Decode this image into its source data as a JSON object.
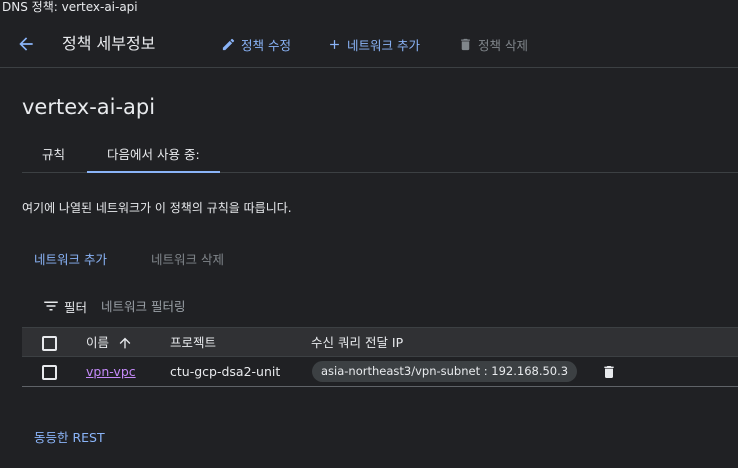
{
  "window": {
    "title": "DNS 정책: vertex-ai-api"
  },
  "toolbar": {
    "heading": "정책 세부정보",
    "edit_label": "정책 수정",
    "add_network_label": "네트워크 추가",
    "delete_policy_label": "정책 삭제"
  },
  "policy": {
    "name": "vertex-ai-api"
  },
  "tabs": [
    {
      "label": "규칙",
      "active": false
    },
    {
      "label": "다음에서 사용 중:",
      "active": true
    }
  ],
  "description": "여기에 나열된 네트워크가 이 정책의 규칙을 따릅니다.",
  "actions": {
    "add_network": "네트워크 추가",
    "delete_network": "네트워크 삭제"
  },
  "filter": {
    "label": "필터",
    "placeholder": "네트워크 필터링"
  },
  "table": {
    "columns": {
      "name": "이름",
      "project": "프로젝트",
      "forwarding_ip": "수신 쿼리 전달 IP"
    },
    "rows": [
      {
        "name": "vpn-vpc",
        "project": "ctu-gcp-dsa2-unit",
        "forwarding_ip": "asia-northeast3/vpn-subnet : 192.168.50.3"
      }
    ]
  },
  "footer": {
    "equivalent_rest": "동등한 REST"
  },
  "icons": {
    "back": "arrow-left-icon",
    "edit": "pencil-icon",
    "add": "plus-icon",
    "delete": "trash-icon",
    "filter": "filter-list-icon",
    "sort": "arrow-up-icon"
  },
  "colors": {
    "background": "#202124",
    "accent": "#8ab4f8",
    "link_visited": "#c58af9",
    "disabled": "#80868b",
    "header_bg": "#303134"
  }
}
